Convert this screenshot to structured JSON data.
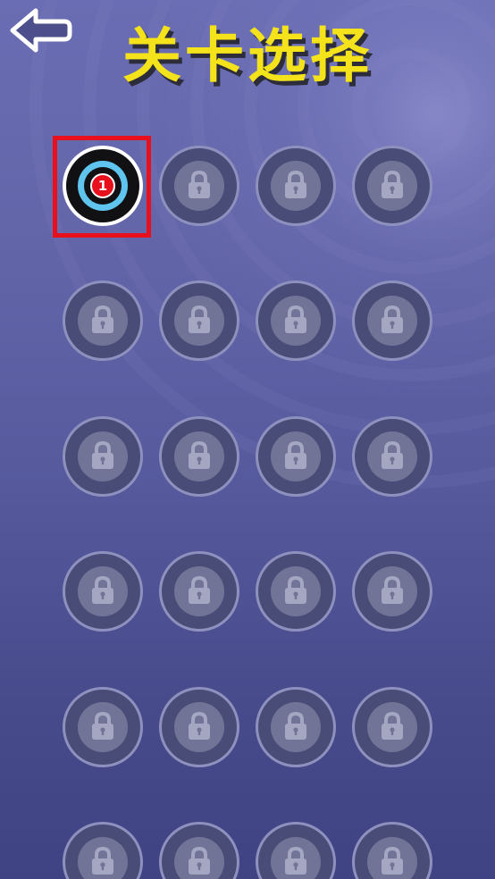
{
  "header": {
    "title": "关卡选择",
    "back_icon": "back-arrow-icon"
  },
  "colors": {
    "title": "#f4e21a",
    "title_shadow": "#2c2c3a",
    "selection_border": "#e8101c",
    "target_blue": "#5fc5ee",
    "target_red": "#e8101c"
  },
  "levels": [
    {
      "number": "1",
      "state": "unlocked",
      "selected": true
    },
    {
      "state": "locked",
      "icon": "lock-icon"
    },
    {
      "state": "locked",
      "icon": "lock-icon"
    },
    {
      "state": "locked",
      "icon": "lock-icon"
    },
    {
      "state": "locked",
      "icon": "lock-icon"
    },
    {
      "state": "locked",
      "icon": "lock-icon"
    },
    {
      "state": "locked",
      "icon": "lock-icon"
    },
    {
      "state": "locked",
      "icon": "lock-icon"
    },
    {
      "state": "locked",
      "icon": "lock-icon"
    },
    {
      "state": "locked",
      "icon": "lock-icon"
    },
    {
      "state": "locked",
      "icon": "lock-icon"
    },
    {
      "state": "locked",
      "icon": "lock-icon"
    },
    {
      "state": "locked",
      "icon": "lock-icon"
    },
    {
      "state": "locked",
      "icon": "lock-icon"
    },
    {
      "state": "locked",
      "icon": "lock-icon"
    },
    {
      "state": "locked",
      "icon": "lock-icon"
    },
    {
      "state": "locked",
      "icon": "lock-icon"
    },
    {
      "state": "locked",
      "icon": "lock-icon"
    },
    {
      "state": "locked",
      "icon": "lock-icon"
    },
    {
      "state": "locked",
      "icon": "lock-icon"
    },
    {
      "state": "locked",
      "icon": "lock-icon"
    },
    {
      "state": "locked",
      "icon": "lock-icon"
    },
    {
      "state": "locked",
      "icon": "lock-icon"
    },
    {
      "state": "locked",
      "icon": "lock-icon"
    }
  ]
}
